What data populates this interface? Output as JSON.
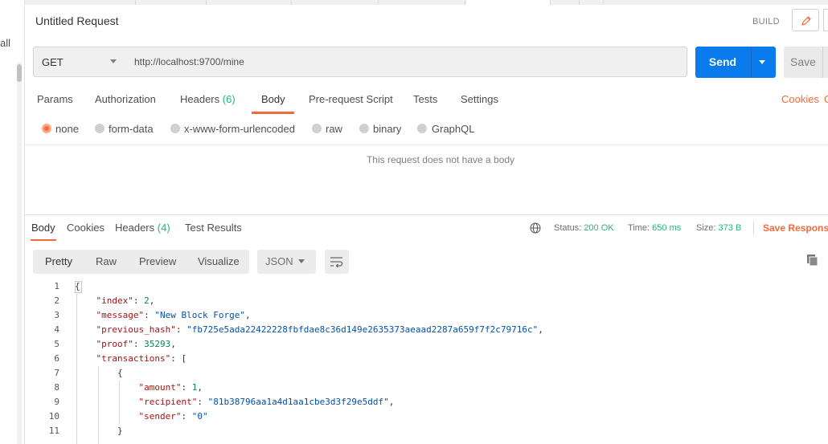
{
  "sidebar": {
    "partial_text": "all"
  },
  "request": {
    "title": "Untitled Request",
    "build_label": "BUILD",
    "method": "GET",
    "url": "http://localhost:9700/mine",
    "send_label": "Send",
    "save_label": "Save"
  },
  "request_tabs": [
    {
      "label": "Params"
    },
    {
      "label": "Authorization"
    },
    {
      "label": "Headers",
      "count": "(6)"
    },
    {
      "label": "Body"
    },
    {
      "label": "Pre-request Script"
    },
    {
      "label": "Tests"
    },
    {
      "label": "Settings"
    }
  ],
  "active_request_tab": "Body",
  "cookies_label": "Cookies",
  "cookies_partial": "C",
  "body_types": [
    "none",
    "form-data",
    "x-www-form-urlencoded",
    "raw",
    "binary",
    "GraphQL"
  ],
  "selected_body_type": "none",
  "no_body_message": "This request does not have a body",
  "response_tabs": [
    {
      "label": "Body"
    },
    {
      "label": "Cookies"
    },
    {
      "label": "Headers",
      "count": "(4)"
    },
    {
      "label": "Test Results"
    }
  ],
  "active_response_tab": "Body",
  "response_meta": {
    "status_label": "Status:",
    "status_value": "200 OK",
    "time_label": "Time:",
    "time_value": "650 ms",
    "size_label": "Size:",
    "size_value": "373 B",
    "save_response_label": "Save Response"
  },
  "view_modes": [
    "Pretty",
    "Raw",
    "Preview",
    "Visualize"
  ],
  "active_view_mode": "Pretty",
  "format": "JSON",
  "code_lines": [
    {
      "num": "1",
      "text": "{"
    },
    {
      "num": "2",
      "text": "    \"index\": 2,"
    },
    {
      "num": "3",
      "text": "    \"message\": \"New Block Forge\","
    },
    {
      "num": "4",
      "text": "    \"previous_hash\": \"fb725e5ada22422228fbfdae8c36d149e2635373aeaad2287a659f7f2c79716c\","
    },
    {
      "num": "5",
      "text": "    \"proof\": 35293,"
    },
    {
      "num": "6",
      "text": "    \"transactions\": ["
    },
    {
      "num": "7",
      "text": "        {"
    },
    {
      "num": "8",
      "text": "            \"amount\": 1,"
    },
    {
      "num": "9",
      "text": "            \"recipient\": \"81b38796aa1a4d1aa1cbe3d3f29e5ddf\","
    },
    {
      "num": "10",
      "text": "            \"sender\": \"0\""
    },
    {
      "num": "11",
      "text": "        }"
    }
  ],
  "colors": {
    "accent": "#f26b3a",
    "send": "#097bed",
    "success": "#26b47f",
    "json_key": "#a31515",
    "json_string": "#0451a5",
    "json_number": "#098658"
  }
}
